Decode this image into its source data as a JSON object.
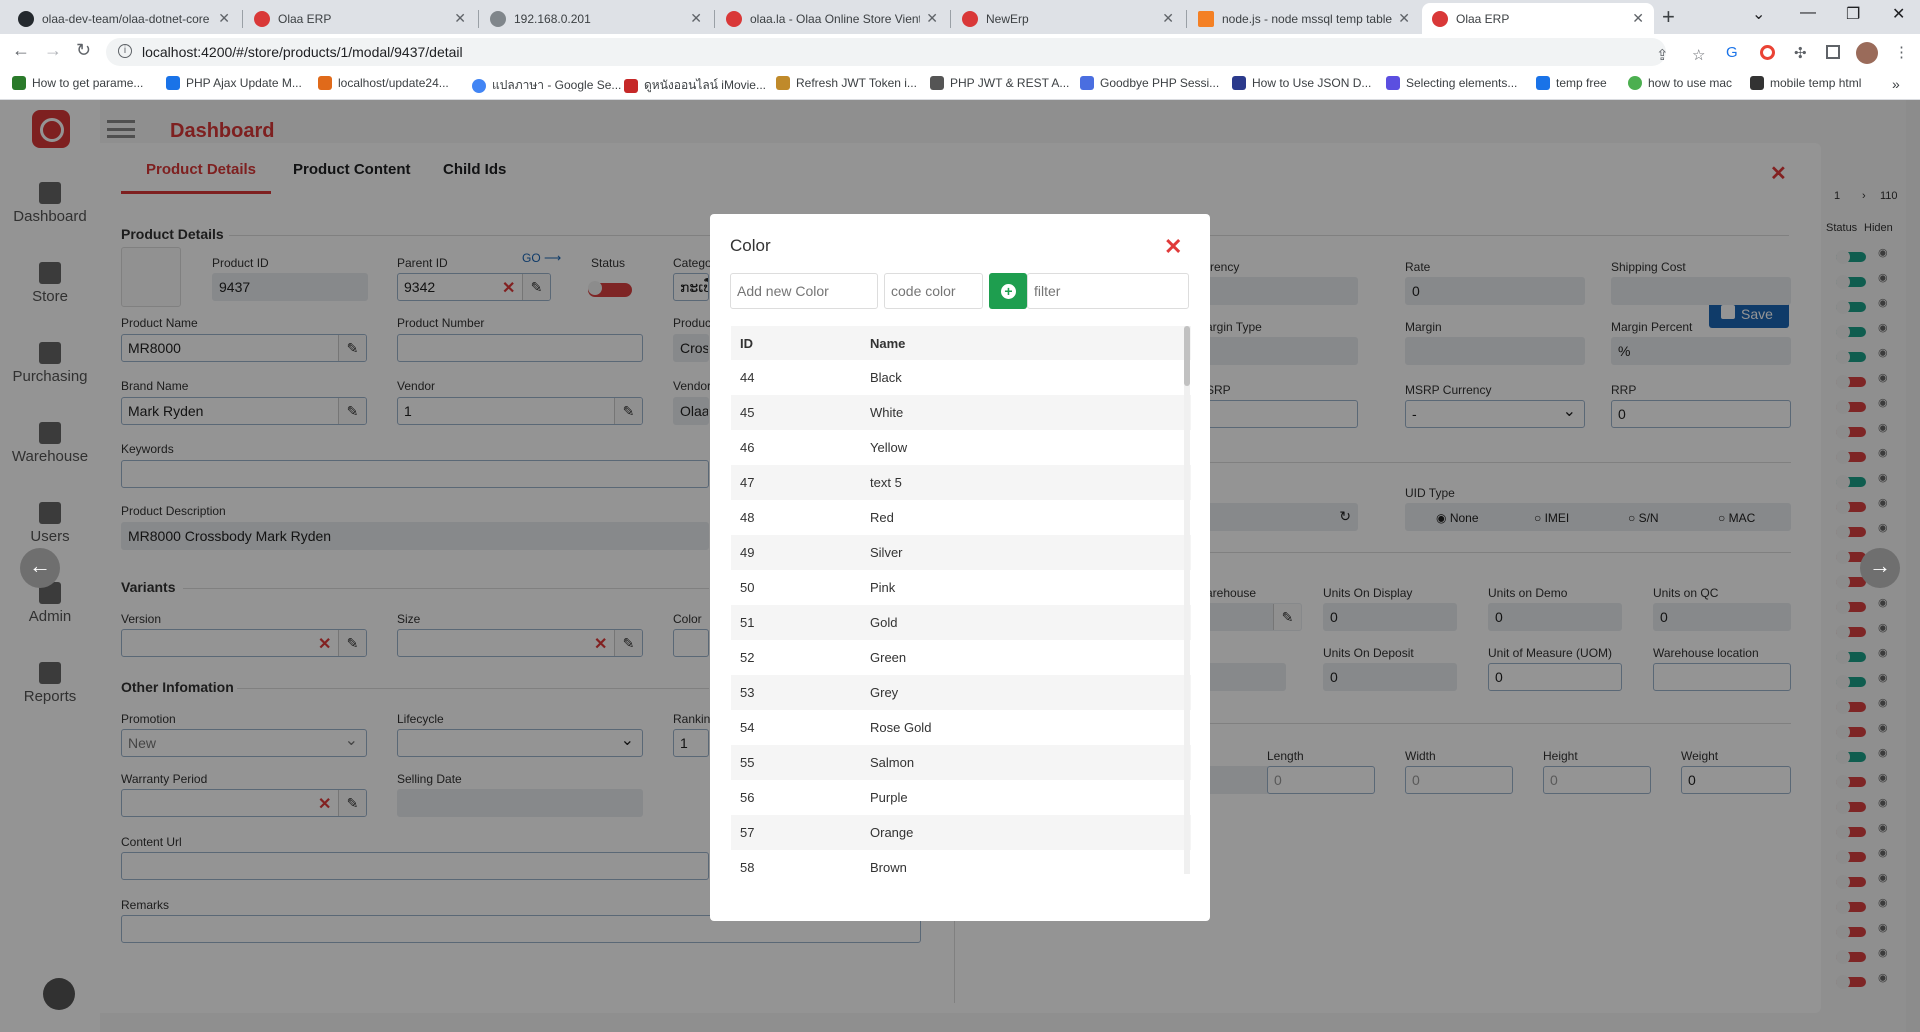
{
  "browser": {
    "tabs": [
      {
        "title": "olaa-dev-team/olaa-dotnet-core",
        "favicon": "github-icon"
      },
      {
        "title": "Olaa ERP",
        "favicon": "olaa-icon"
      },
      {
        "title": "192.168.0.201",
        "favicon": "globe-icon"
      },
      {
        "title": "olaa.la - Olaa Online Store Vientiane",
        "favicon": "olaa-icon"
      },
      {
        "title": "NewErp",
        "favicon": "olaa-icon"
      },
      {
        "title": "node.js - node mssql temp table",
        "favicon": "stackoverflow-icon"
      },
      {
        "title": "Olaa ERP",
        "favicon": "olaa-icon",
        "active": true
      }
    ],
    "url": "localhost:4200/#/store/products/1/modal/9437/detail",
    "bookmarks": [
      "How to get parame...",
      "PHP Ajax Update M...",
      "localhost/update24...",
      "แปลภาษา - Google Se...",
      "ดูหนังออนไลน์ iMovie...",
      "Refresh JWT Token i...",
      "PHP JWT & REST A...",
      "Goodbye PHP Sessi...",
      "How to Use JSON D...",
      "Selecting elements...",
      "temp free",
      "how to use mac",
      "mobile temp html"
    ]
  },
  "app": {
    "header_title": "Dashboard",
    "sidebar": [
      "Dashboard",
      "Store",
      "Purchasing",
      "Warehouse",
      "Users",
      "Admin",
      "Reports"
    ]
  },
  "product": {
    "tabs": [
      "Product Details",
      "Product Content",
      "Child Ids"
    ],
    "section_details": "Product Details",
    "product_id_label": "Product ID",
    "product_id": "9437",
    "parent_id_label": "Parent ID",
    "parent_id": "9342",
    "go_label": "GO",
    "status_label": "Status",
    "category_label": "Category",
    "category_value": "ກະເປົ໋",
    "product_name_label": "Product Name",
    "product_name": "MR8000",
    "product_number_label": "Product Number",
    "product_type_label": "Product",
    "product_type_value": "Cross",
    "brand_label": "Brand Name",
    "brand": "Mark Ryden",
    "vendor_label": "Vendor",
    "vendor": "1",
    "vendor_name_label": "Vendor",
    "vendor_name": "Olaa",
    "keywords_label": "Keywords",
    "description_label": "Product Description",
    "description": "MR8000 Crossbody Mark Ryden",
    "section_variants": "Variants",
    "version_label": "Version",
    "size_label": "Size",
    "color_label": "Color",
    "section_other": "Other Infomation",
    "promotion_label": "Promotion",
    "promotion": "New",
    "lifecycle_label": "Lifecycle",
    "ranking_label": "Ranking",
    "ranking": "1",
    "warranty_label": "Warranty Period",
    "selling_date_label": "Selling Date",
    "content_url_label": "Content Url",
    "remarks_label": "Remarks"
  },
  "right": {
    "save_label": "Save",
    "currency_label": "rrency",
    "rate_label": "Rate",
    "rate": "0",
    "shipping_label": "Shipping Cost",
    "margin_type_label": "argin Type",
    "margin_label": "Margin",
    "margin_percent_label": "Margin Percent",
    "margin_percent": "%",
    "srp_label": "SRP",
    "msrp_currency_label": "MSRP Currency",
    "msrp_currency": "-",
    "rrp_label": "RRP",
    "rrp": "0",
    "uid_type_label": "UID Type",
    "uid_options": [
      "None",
      "IMEI",
      "S/N",
      "MAC"
    ],
    "warehouse_label": "arehouse",
    "units_display_label": "Units On Display",
    "units_display": "0",
    "units_demo_label": "Units on Demo",
    "units_demo": "0",
    "units_qc_label": "Units on QC",
    "units_qc": "0",
    "units_deposit_label": "Units On Deposit",
    "units_deposit": "0",
    "uom_label": "Unit of Measure (UOM)",
    "uom": "0",
    "wh_location_label": "Warehouse location",
    "length_label": "Length",
    "length": "0",
    "width_label": "Width",
    "width": "0",
    "height_label": "Height",
    "height": "0",
    "weight_label": "Weight",
    "weight": "0"
  },
  "list_panel": {
    "page": "1",
    "total": "110",
    "status_label": "Status",
    "hidden_label": "Hiden",
    "toggles": [
      "on",
      "on",
      "on",
      "on",
      "on",
      "off",
      "off",
      "off",
      "off",
      "on",
      "off",
      "off",
      "off",
      "off",
      "off",
      "off",
      "on",
      "on",
      "off",
      "off",
      "on",
      "off",
      "off",
      "off",
      "off",
      "off",
      "off",
      "off",
      "off",
      "off"
    ]
  },
  "modal": {
    "title": "Color",
    "add_placeholder": "Add new Color",
    "code_placeholder": "code color",
    "filter_placeholder": "filter",
    "col_id": "ID",
    "col_name": "Name",
    "rows": [
      {
        "id": "44",
        "name": "Black"
      },
      {
        "id": "45",
        "name": "White"
      },
      {
        "id": "46",
        "name": "Yellow"
      },
      {
        "id": "47",
        "name": "text 5"
      },
      {
        "id": "48",
        "name": "Red"
      },
      {
        "id": "49",
        "name": "Silver"
      },
      {
        "id": "50",
        "name": "Pink"
      },
      {
        "id": "51",
        "name": "Gold"
      },
      {
        "id": "52",
        "name": "Green"
      },
      {
        "id": "53",
        "name": "Grey"
      },
      {
        "id": "54",
        "name": "Rose Gold"
      },
      {
        "id": "55",
        "name": "Salmon"
      },
      {
        "id": "56",
        "name": "Purple"
      },
      {
        "id": "57",
        "name": "Orange"
      },
      {
        "id": "58",
        "name": "Brown"
      }
    ]
  }
}
